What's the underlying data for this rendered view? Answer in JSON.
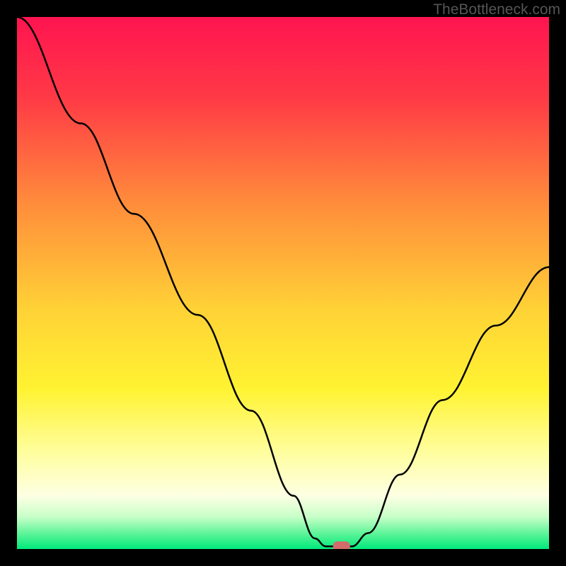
{
  "watermark": "TheBottleneck.com",
  "chart_data": {
    "type": "line",
    "title": "",
    "xlabel": "",
    "ylabel": "",
    "xlim": [
      0,
      100
    ],
    "ylim": [
      0,
      100
    ],
    "background_gradient": {
      "stops": [
        {
          "offset": 0.0,
          "color": "#ff1450"
        },
        {
          "offset": 0.15,
          "color": "#ff3946"
        },
        {
          "offset": 0.35,
          "color": "#ff8c3b"
        },
        {
          "offset": 0.55,
          "color": "#ffd236"
        },
        {
          "offset": 0.7,
          "color": "#fff332"
        },
        {
          "offset": 0.82,
          "color": "#fffea0"
        },
        {
          "offset": 0.9,
          "color": "#fdffe3"
        },
        {
          "offset": 0.94,
          "color": "#c7ffc8"
        },
        {
          "offset": 0.97,
          "color": "#60f59a"
        },
        {
          "offset": 1.0,
          "color": "#00e97b"
        }
      ]
    },
    "curve": [
      {
        "x": 0,
        "y": 100
      },
      {
        "x": 12,
        "y": 80
      },
      {
        "x": 22,
        "y": 63
      },
      {
        "x": 34,
        "y": 44
      },
      {
        "x": 44,
        "y": 26
      },
      {
        "x": 52,
        "y": 10
      },
      {
        "x": 56,
        "y": 2
      },
      {
        "x": 58,
        "y": 0.5
      },
      {
        "x": 63,
        "y": 0.5
      },
      {
        "x": 66,
        "y": 3
      },
      {
        "x": 72,
        "y": 14
      },
      {
        "x": 80,
        "y": 28
      },
      {
        "x": 90,
        "y": 42
      },
      {
        "x": 100,
        "y": 53
      }
    ],
    "marker": {
      "x": 61,
      "y": 0.5,
      "color": "#d36b6b"
    }
  }
}
